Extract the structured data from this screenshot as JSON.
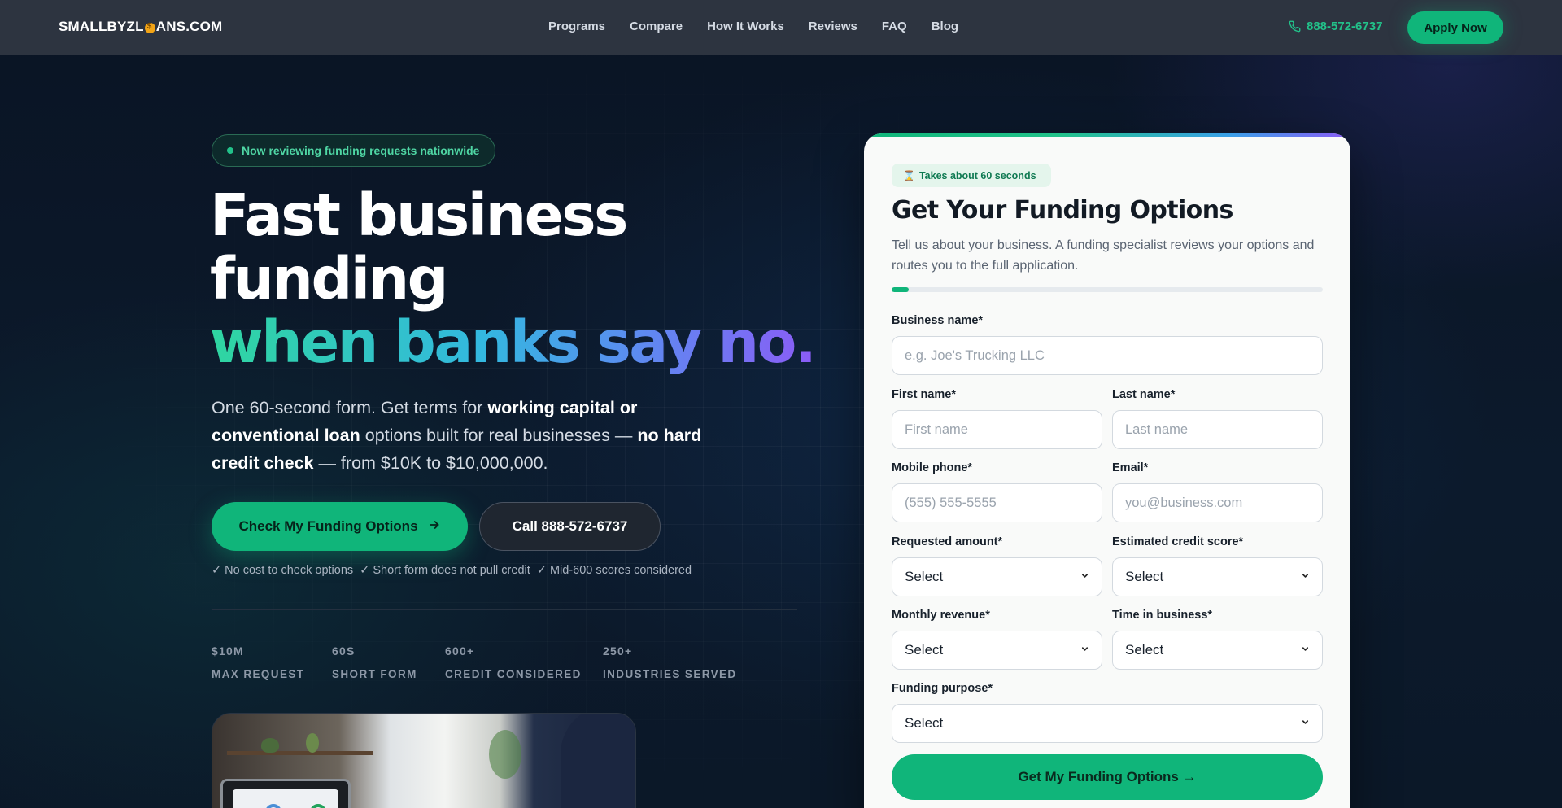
{
  "header": {
    "logo_pre": "SMALLBYZL",
    "logo_post": "ANS.COM",
    "nav": [
      "Programs",
      "Compare",
      "How It Works",
      "Reviews",
      "FAQ",
      "Blog"
    ],
    "phone": "888-572-6737",
    "apply_label": "Apply Now"
  },
  "hero": {
    "badge": "Now reviewing funding requests nationwide",
    "headline_line1": "Fast business",
    "headline_line2": "funding",
    "headline_line3": "when banks say no.",
    "sub": {
      "p1": "One 60-second form. Get terms for ",
      "b1": "working capital or conventional loan",
      "p2": " options built for real businesses — ",
      "b2": "no hard credit check",
      "p3": " — from $10K to $10,000,000."
    },
    "cta_primary": "Check My Funding Options",
    "cta_secondary": "Call 888-572-6737",
    "checks": [
      "✓ No cost to check options",
      "✓ Short form does not pull credit",
      "✓ Mid-600 scores considered"
    ],
    "stats": [
      {
        "value": "$10M",
        "label": "MAX REQUEST"
      },
      {
        "value": "60S",
        "label": "SHORT FORM"
      },
      {
        "value": "600+",
        "label": "CREDIT CONSIDERED"
      },
      {
        "value": "250+",
        "label": "INDUSTRIES SERVED"
      }
    ]
  },
  "form": {
    "time_pill": "Takes about 60 seconds",
    "title": "Get Your Funding Options",
    "description": "Tell us about your business. A funding specialist reviews your options and routes you to the full application.",
    "progress": 0.04,
    "business_name": {
      "label": "Business name*",
      "placeholder": "e.g. Joe's Trucking LLC"
    },
    "first_name": {
      "label": "First name*",
      "placeholder": "First name"
    },
    "last_name": {
      "label": "Last name*",
      "placeholder": "Last name"
    },
    "mobile_phone": {
      "label": "Mobile phone*",
      "placeholder": "(555) 555-5555"
    },
    "email": {
      "label": "Email*",
      "placeholder": "you@business.com"
    },
    "requested_amount": {
      "label": "Requested amount*",
      "value": "Select"
    },
    "credit_score": {
      "label": "Estimated credit score*",
      "value": "Select"
    },
    "monthly_revenue": {
      "label": "Monthly revenue*",
      "value": "Select"
    },
    "time_in_business": {
      "label": "Time in business*",
      "value": "Select"
    },
    "funding_purpose": {
      "label": "Funding purpose*",
      "value": "Select"
    },
    "submit_label": "Get My Funding Options →"
  },
  "colors": {
    "accent": "#10b57a",
    "header_bg": "#2d3440",
    "page_bg": "#0b1626",
    "card_bg": "#f9faf9"
  },
  "icons": {
    "phone": "phone-icon",
    "arrow": "arrow-right-icon",
    "hourglass": "hourglass-icon",
    "chevron": "chevron-down-icon"
  }
}
